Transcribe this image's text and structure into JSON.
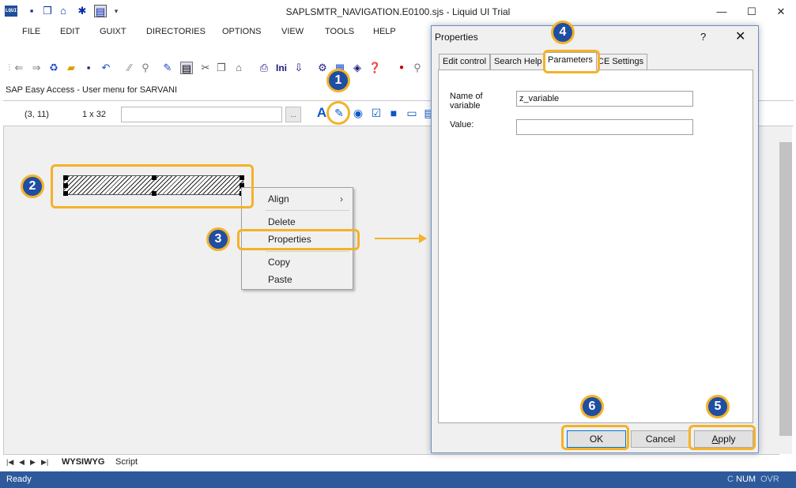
{
  "window": {
    "title": "SAPLSMTR_NAVIGATION.E0100.sjs - Liquid UI Trial",
    "app_icon_text": "LQUI",
    "minimize": "—",
    "maximize": "☐",
    "close": "✕"
  },
  "menu": {
    "items": [
      "FILE",
      "EDIT",
      "GUIXT",
      "DIRECTORIES",
      "OPTIONS",
      "VIEW",
      "TOOLS",
      "HELP"
    ]
  },
  "breadcrumb": "SAP Easy Access  -  User menu for SARVANI",
  "property_bar": {
    "coords": "(3, 11)",
    "size": "1 x 32",
    "name_value": "",
    "browse_label": "..."
  },
  "context_menu": {
    "items": [
      "Align",
      "Delete",
      "Properties",
      "Copy",
      "Paste"
    ]
  },
  "dialog": {
    "title": "Properties",
    "help": "?",
    "close": "✕",
    "tabs": [
      "Edit control",
      "Search Help",
      "Parameters",
      "CE Settings"
    ],
    "active_tab": "Parameters",
    "fields": {
      "name_label": "Name of variable",
      "name_value": "z_variable",
      "value_label": "Value:",
      "value_value": ""
    },
    "buttons": {
      "ok": "OK",
      "cancel": "Cancel",
      "apply": "Apply"
    }
  },
  "steps": [
    "1",
    "2",
    "3",
    "4",
    "5",
    "6"
  ],
  "bottom_tabs": [
    "WYSIWYG",
    "Script"
  ],
  "status": {
    "left": "Ready",
    "caps": "C",
    "num": "NUM",
    "ovr": "OVR"
  },
  "colors": {
    "highlight": "#f4b22a",
    "badge": "#1f4ea3",
    "statusbar": "#2e5a9c"
  }
}
